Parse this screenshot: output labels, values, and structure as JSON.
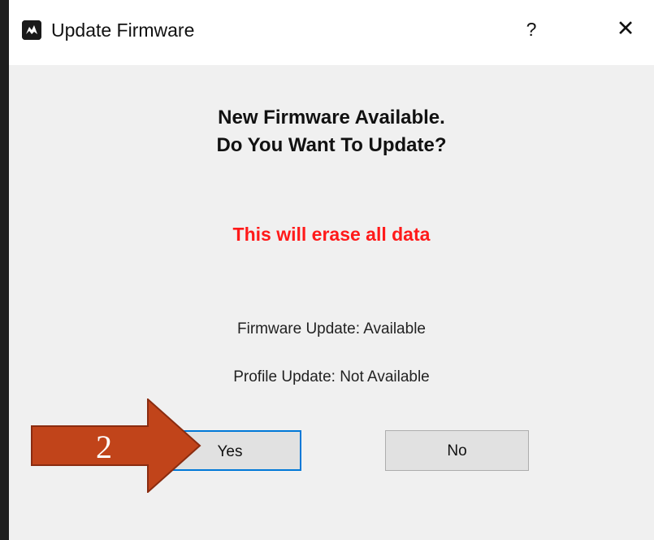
{
  "window": {
    "title": "Update Firmware",
    "help_label": "?",
    "close_label": "✕"
  },
  "message": {
    "line1": "New Firmware Available.",
    "line2": "Do You Want To Update?",
    "warning": "This will erase all data",
    "warning_color": "#ff1a1a"
  },
  "status": {
    "firmware": "Firmware Update:  Available",
    "profile": "Profile Update:  Not Available"
  },
  "buttons": {
    "yes": "Yes",
    "no": "No"
  },
  "annotation": {
    "step_number": "2",
    "arrow_color": "#c1441a"
  },
  "icons": {
    "app": "app-logo-icon",
    "help": "help-icon",
    "close": "close-icon"
  }
}
